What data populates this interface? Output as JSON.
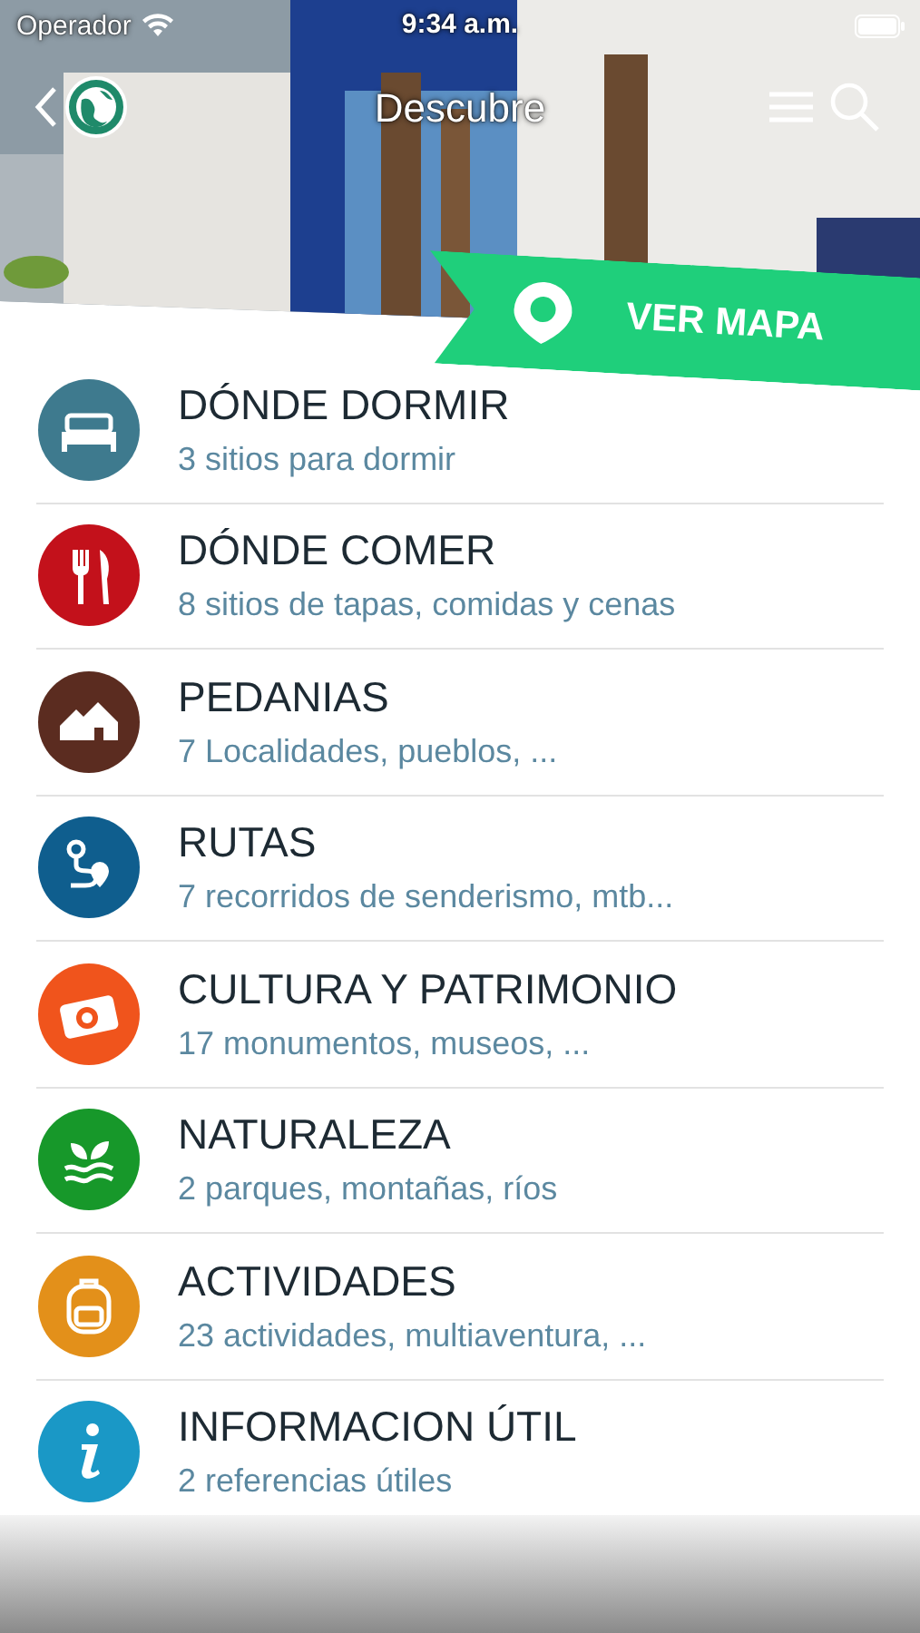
{
  "status_bar": {
    "carrier": "Operador",
    "time": "9:34 a.m."
  },
  "nav_bar": {
    "title": "Descubre"
  },
  "map_button": {
    "label": "VER MAPA"
  },
  "items": [
    {
      "title": "DÓNDE DORMIR",
      "subtitle": "3 sitios para dormir",
      "kind": "bed",
      "color": "#3e7a8e"
    },
    {
      "title": "DÓNDE COMER",
      "subtitle": "8 sitios de tapas, comidas y cenas",
      "kind": "cutlery",
      "color": "#c3111b"
    },
    {
      "title": "PEDANIAS",
      "subtitle": "7 Localidades, pueblos, ...",
      "kind": "houses",
      "color": "#5b2c20"
    },
    {
      "title": "RUTAS",
      "subtitle": "7 recorridos de senderismo, mtb...",
      "kind": "route",
      "color": "#0f5e8e"
    },
    {
      "title": "CULTURA Y PATRIMONIO",
      "subtitle": "17 monumentos, museos, ...",
      "kind": "camera",
      "color": "#f0541c"
    },
    {
      "title": "NATURALEZA",
      "subtitle": "2 parques, montañas, ríos",
      "kind": "nature",
      "color": "#17982a"
    },
    {
      "title": "ACTIVIDADES",
      "subtitle": "23 actividades, multiaventura, ...",
      "kind": "backpack",
      "color": "#e3901a"
    },
    {
      "title": "INFORMACION ÚTIL",
      "subtitle": "2 referencias útiles",
      "kind": "info",
      "color": "#1a98c6"
    }
  ]
}
